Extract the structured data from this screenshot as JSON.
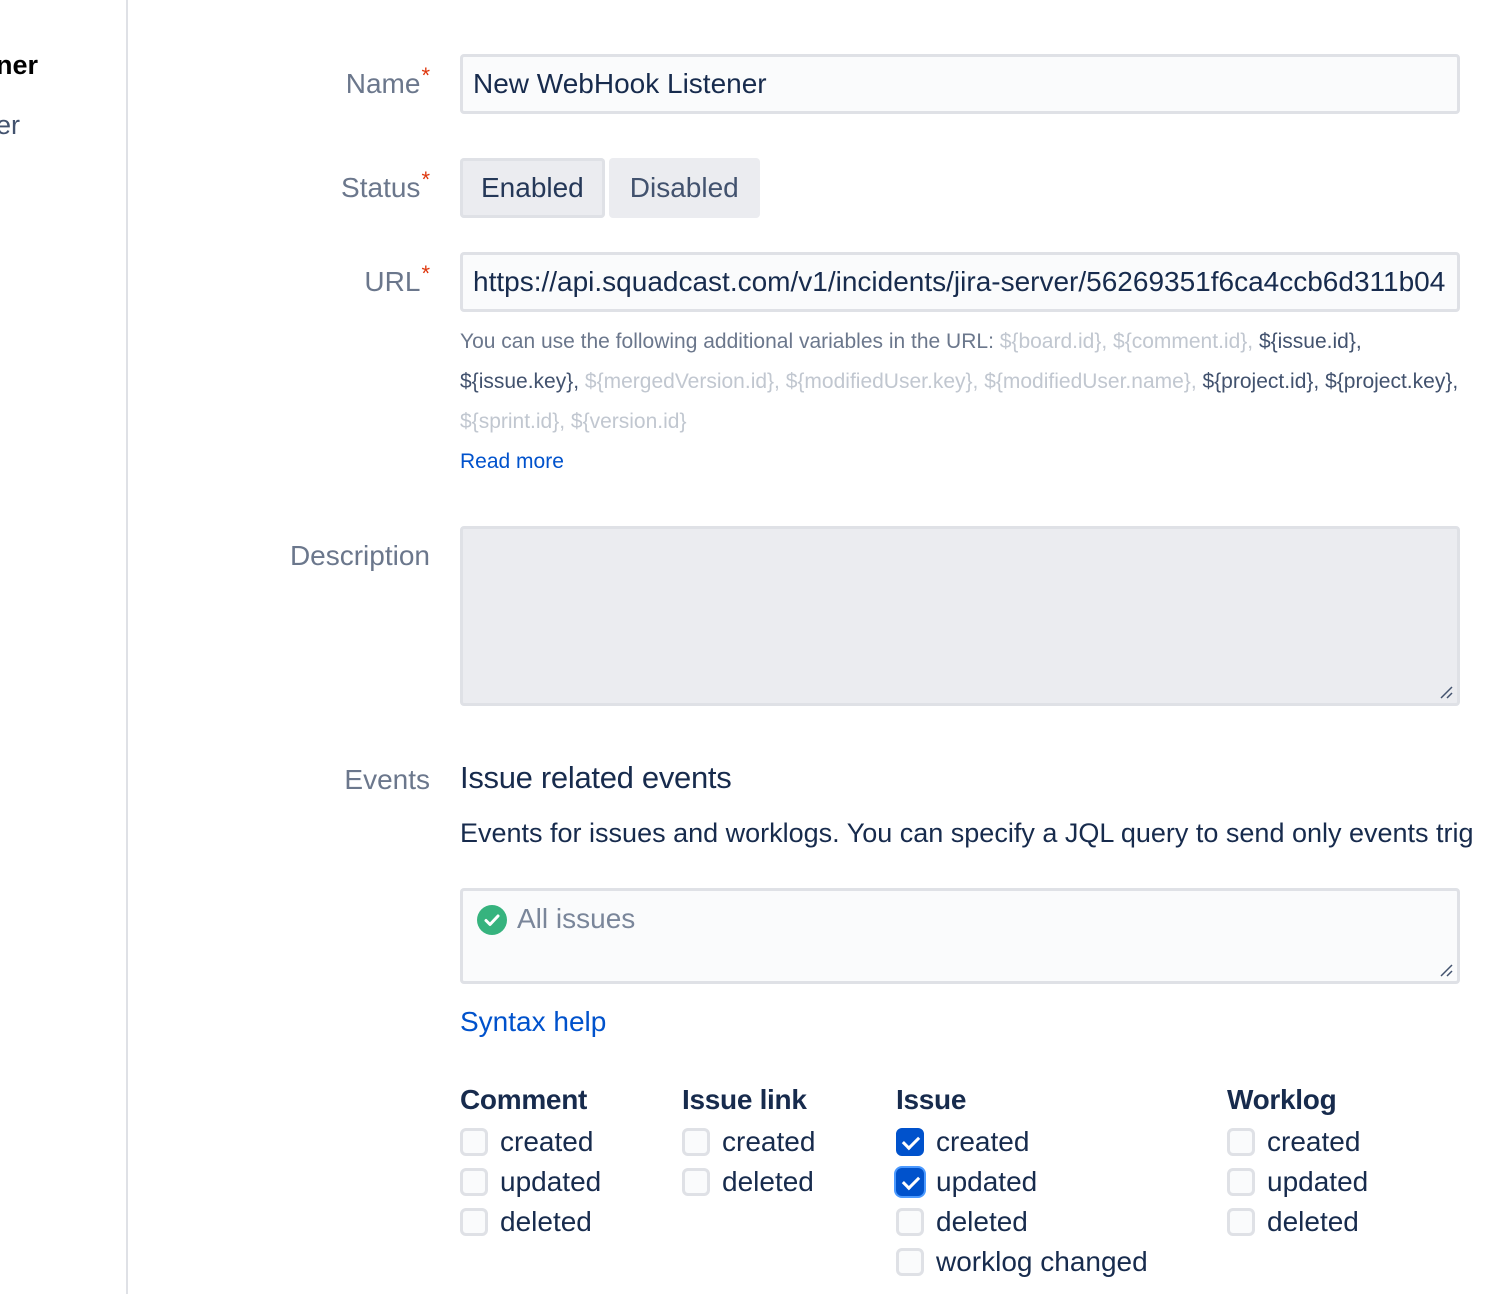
{
  "sidebar": {
    "item1_fragment": "ner",
    "item2_fragment": "er"
  },
  "form": {
    "name": {
      "label": "Name",
      "required_mark": "*",
      "value": "New WebHook Listener"
    },
    "status": {
      "label": "Status",
      "required_mark": "*",
      "options": [
        "Enabled",
        "Disabled"
      ],
      "selected": "Enabled"
    },
    "url": {
      "label": "URL",
      "required_mark": "*",
      "value": "https://api.squadcast.com/v1/incidents/jira-server/56269351f6ca4ccb6d311b04",
      "help_intro": "You can use the following additional variables in the URL: ",
      "variables": [
        {
          "text": "${board.id}, ",
          "enabled": false
        },
        {
          "text": "${comment.id}, ",
          "enabled": false
        },
        {
          "text": "${issue.id}, ",
          "enabled": true
        },
        {
          "text": "${issue.key}, ",
          "enabled": true
        },
        {
          "text": "${mergedVersion.id}, ",
          "enabled": false
        },
        {
          "text": "${modifiedUser.key}, ",
          "enabled": false
        },
        {
          "text": "${modifiedUser.name}, ",
          "enabled": false
        },
        {
          "text": "${project.id}, ",
          "enabled": true
        },
        {
          "text": "${project.key}, ",
          "enabled": true
        },
        {
          "text": "${sprint.id}, ",
          "enabled": false
        },
        {
          "text": "${version.id}",
          "enabled": false
        }
      ],
      "read_more": "Read more"
    },
    "description": {
      "label": "Description",
      "value": ""
    },
    "events": {
      "label": "Events",
      "section_title": "Issue related events",
      "section_desc": "Events for issues and worklogs. You can specify a JQL query to send only events trig",
      "jql_placeholder": "All issues",
      "syntax_help": "Syntax help",
      "groups": [
        {
          "title": "Comment",
          "items": [
            {
              "label": "created",
              "checked": false
            },
            {
              "label": "updated",
              "checked": false
            },
            {
              "label": "deleted",
              "checked": false
            }
          ]
        },
        {
          "title": "Issue link",
          "items": [
            {
              "label": "created",
              "checked": false
            },
            {
              "label": "deleted",
              "checked": false
            }
          ]
        },
        {
          "title": "Issue",
          "items": [
            {
              "label": "created",
              "checked": true
            },
            {
              "label": "updated",
              "checked": true
            },
            {
              "label": "deleted",
              "checked": false
            },
            {
              "label": "worklog changed",
              "checked": false
            }
          ]
        },
        {
          "title": "Worklog",
          "items": [
            {
              "label": "created",
              "checked": false
            },
            {
              "label": "updated",
              "checked": false
            },
            {
              "label": "deleted",
              "checked": false
            }
          ]
        }
      ]
    }
  },
  "colors": {
    "required": "#de350b",
    "link": "#0052cc",
    "checked": "#0052cc",
    "success": "#36b37e"
  }
}
